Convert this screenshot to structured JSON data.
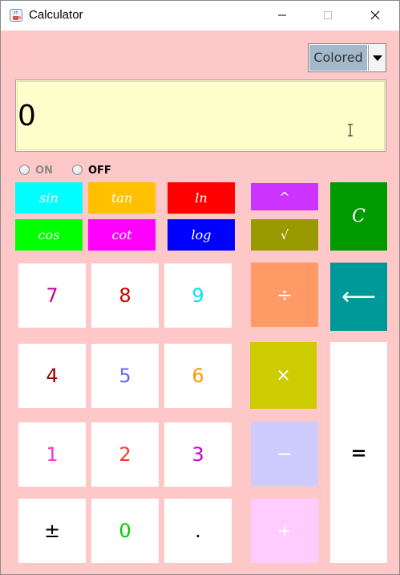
{
  "window": {
    "title": "Calculator"
  },
  "mode": {
    "selected": "Colored"
  },
  "display": {
    "value": "0"
  },
  "power": {
    "on_label": "ON",
    "off_label": "OFF"
  },
  "functions": {
    "sin": "sin",
    "tan": "tan",
    "ln": "ln",
    "cos": "cos",
    "cot": "cot",
    "log": "log",
    "power": "^",
    "sqrt": "√",
    "clear": "C"
  },
  "keys": {
    "seven": "7",
    "eight": "8",
    "nine": "9",
    "four": "4",
    "five": "5",
    "six": "6",
    "one": "1",
    "two": "2",
    "three": "3",
    "plus_minus": "±",
    "zero": "0",
    "decimal": ".",
    "divide": "÷",
    "multiply": "×",
    "subtract": "−",
    "add": "+",
    "backspace": "⟵",
    "equals": "="
  },
  "colors": {
    "background": "#ffc8c8",
    "display": "#ffffcc",
    "sin": "#00ffff",
    "tan": "#ffc000",
    "ln": "#ff0000",
    "cos": "#00ff00",
    "cot": "#ff00ff",
    "log": "#0000ff",
    "power": "#cc33ff",
    "sqrt": "#999900",
    "clear": "#009900",
    "divide": "#ff9966",
    "multiply": "#cccc00",
    "subtract": "#ccccff",
    "add": "#ffccff",
    "backspace": "#009999"
  }
}
